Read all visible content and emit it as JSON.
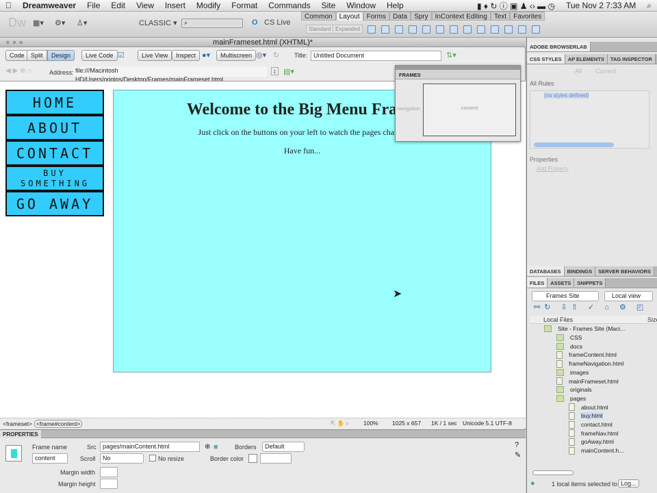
{
  "menubar": {
    "app": "Dreamweaver",
    "items": [
      "File",
      "Edit",
      "View",
      "Insert",
      "Modify",
      "Format",
      "Commands",
      "Site",
      "Window",
      "Help"
    ],
    "clock": "Tue Nov 2  7:33 AM"
  },
  "apptoolbar": {
    "logo": "Dw",
    "workspace": "CLASSIC ▾",
    "cslive": "CS Live",
    "insert_tabs": [
      "Common",
      "Layout",
      "Forms",
      "Data",
      "Spry",
      "InContext Editing",
      "Text",
      "Favorites"
    ],
    "active_insert_tab": "Layout",
    "standard": "Standard",
    "expanded": "Expanded"
  },
  "document": {
    "title": "mainFrameset.html (XHTML)*",
    "buttons": {
      "code": "Code",
      "split": "Split",
      "design": "Design",
      "live_code": "Live Code",
      "live_view": "Live View",
      "inspect": "Inspect",
      "multiscreen": "Multiscreen"
    },
    "title_label": "Title:",
    "title_value": "Untitled Document",
    "address_label": "Address:",
    "address_value": "file:///Macintosh HD/Users/origins/Desktop/Frames/mainFrameset.html"
  },
  "nav_buttons": [
    "HOME",
    "ABOUT",
    "CONTACT",
    "BUY SOMETHING",
    "GO AWAY"
  ],
  "content": {
    "heading": "Welcome to the Big Menu Frames",
    "line1": "Just click on the buttons on your left to watch the pages change",
    "line2": "Have fun..."
  },
  "frames_panel": {
    "title": "FRAMES",
    "navigation": "navigation",
    "content": "content"
  },
  "statusbar": {
    "tag1": "<frameset>",
    "tag2": "<frame#content>",
    "zoom": "100%",
    "size": "1025 x 657",
    "download": "1K / 1 sec",
    "encoding": "Unicode 5.1 UTF-8"
  },
  "properties": {
    "title": "PROPERTIES",
    "frame_name_label": "Frame name",
    "frame_name": "content",
    "src_label": "Src",
    "src": "pages/mainContent.html",
    "borders_label": "Borders",
    "borders": "Default",
    "scroll_label": "Scroll",
    "scroll": "No",
    "no_resize": "No resize",
    "border_color_label": "Border color",
    "margin_width_label": "Margin width",
    "margin_height_label": "Margin height"
  },
  "right": {
    "browserlab": "ADOBE BROWSERLAB",
    "css_tabs": [
      "CSS STYLES",
      "AP ELEMENTS",
      "TAG INSPECTOR"
    ],
    "all": "All",
    "current": "Current",
    "all_rules": "All Rules",
    "no_styles": "(no styles defined)",
    "properties": "Properties",
    "add_property": "Add Property",
    "db_tabs": [
      "DATABASES",
      "BINDINGS",
      "SERVER BEHAVIORS"
    ],
    "file_tabs": [
      "FILES",
      "ASSETS",
      "SNIPPETS"
    ],
    "site": "Frames Site",
    "view": "Local view",
    "local_files": "Local Files",
    "size_col": "Size",
    "tree": [
      {
        "name": "Site - Frames Site (Maci...",
        "type": "folder",
        "level": 0
      },
      {
        "name": "CSS",
        "type": "folder",
        "level": 1
      },
      {
        "name": "docs",
        "type": "folder",
        "level": 1
      },
      {
        "name": "frameContent.html",
        "type": "file",
        "level": 1
      },
      {
        "name": "frameNavigation.html",
        "type": "file",
        "level": 1
      },
      {
        "name": "images",
        "type": "folder",
        "level": 1
      },
      {
        "name": "mainFrameset.html",
        "type": "file",
        "level": 1
      },
      {
        "name": "originals",
        "type": "folder",
        "level": 1
      },
      {
        "name": "pages",
        "type": "folder",
        "level": 1
      },
      {
        "name": "about.html",
        "type": "file",
        "level": 2
      },
      {
        "name": "buy.html",
        "type": "file",
        "level": 2,
        "selected": true
      },
      {
        "name": "contact.html",
        "type": "file",
        "level": 2
      },
      {
        "name": "frameNav.html",
        "type": "file",
        "level": 2
      },
      {
        "name": "goAway.html",
        "type": "file",
        "level": 2
      },
      {
        "name": "mainContent.h...",
        "type": "file",
        "level": 2
      }
    ],
    "status": "1 local items selected to",
    "log": "Log..."
  }
}
